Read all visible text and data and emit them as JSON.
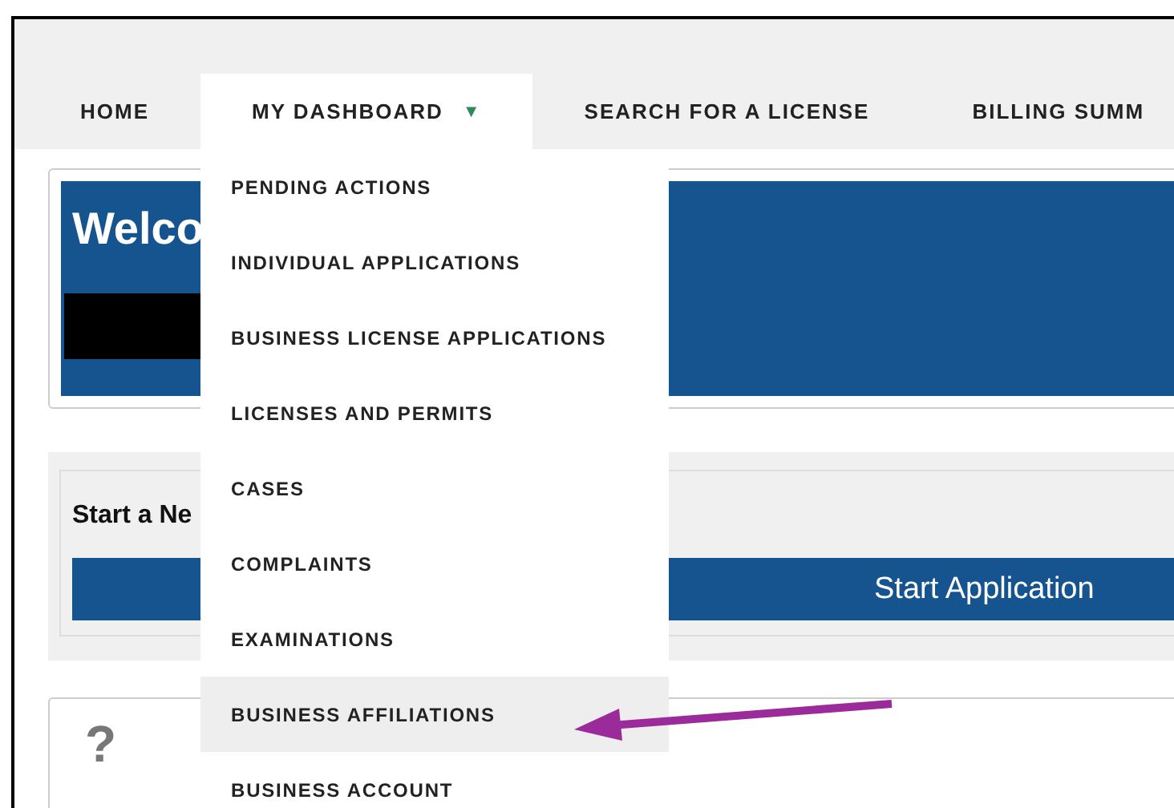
{
  "nav": {
    "tabs": [
      {
        "label": "HOME",
        "selected": false
      },
      {
        "label": "MY DASHBOARD",
        "selected": true,
        "caret": "▼"
      },
      {
        "label": "SEARCH FOR A LICENSE",
        "selected": false
      },
      {
        "label": "BILLING SUMM",
        "selected": false
      }
    ]
  },
  "dropdown": {
    "items": [
      {
        "label": "PENDING ACTIONS",
        "selected": false
      },
      {
        "label": "INDIVIDUAL APPLICATIONS",
        "selected": false
      },
      {
        "label": "BUSINESS LICENSE APPLICATIONS",
        "selected": false
      },
      {
        "label": "LICENSES AND PERMITS",
        "selected": false
      },
      {
        "label": "CASES",
        "selected": false
      },
      {
        "label": "COMPLAINTS",
        "selected": false
      },
      {
        "label": "EXAMINATIONS",
        "selected": false
      },
      {
        "label": "BUSINESS AFFILIATIONS",
        "selected": true
      },
      {
        "label": "BUSINESS ACCOUNT",
        "selected": false
      }
    ]
  },
  "welcome": {
    "title": "Welco",
    "redacted": true
  },
  "start_panel": {
    "title": "Start a Ne",
    "button": "Start Application"
  },
  "help_card": {
    "icon": "?"
  },
  "annotation": {
    "kind": "arrow"
  }
}
